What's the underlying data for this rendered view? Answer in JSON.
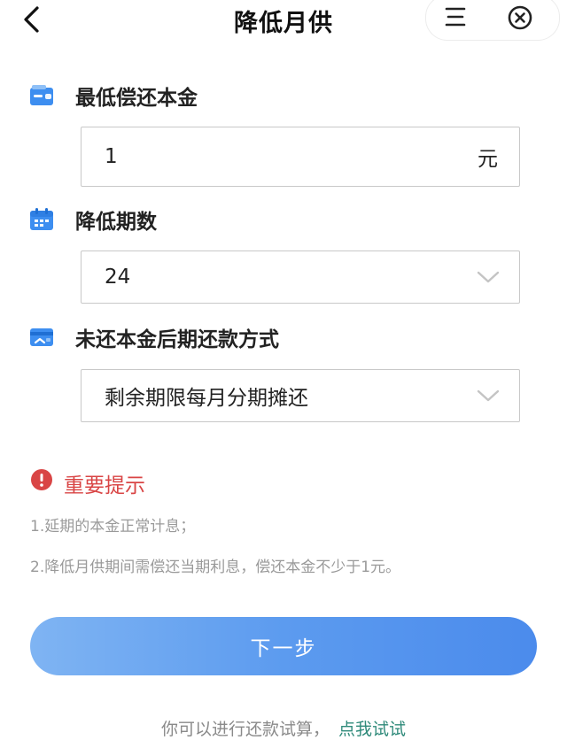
{
  "header": {
    "title": "降低月供",
    "back_icon": "chevron-left-icon",
    "menu_icon": "menu-icon",
    "close_icon": "close-circle-icon"
  },
  "form": {
    "principal": {
      "label": "最低偿还本金",
      "icon": "wallet-icon",
      "value": "1",
      "unit": "元"
    },
    "periods": {
      "label": "降低期数",
      "icon": "calendar-icon",
      "value": "24"
    },
    "repayment_method": {
      "label": "未还本金后期还款方式",
      "icon": "card-icon",
      "value": "剩余期限每月分期摊还"
    }
  },
  "notice": {
    "title": "重要提示",
    "icon": "alert-icon",
    "lines": [
      "1.延期的本金正常计息；",
      "2.降低月供期间需偿还当期利息，偿还本金不少于1元。"
    ]
  },
  "actions": {
    "next_label": "下一步"
  },
  "footer": {
    "text": "你可以进行还款试算，",
    "link": "点我试试"
  },
  "colors": {
    "accent": "#5c9bef",
    "icon_blue": "#3d8ef0",
    "warning": "#d94545",
    "link": "#2f8a7a"
  }
}
